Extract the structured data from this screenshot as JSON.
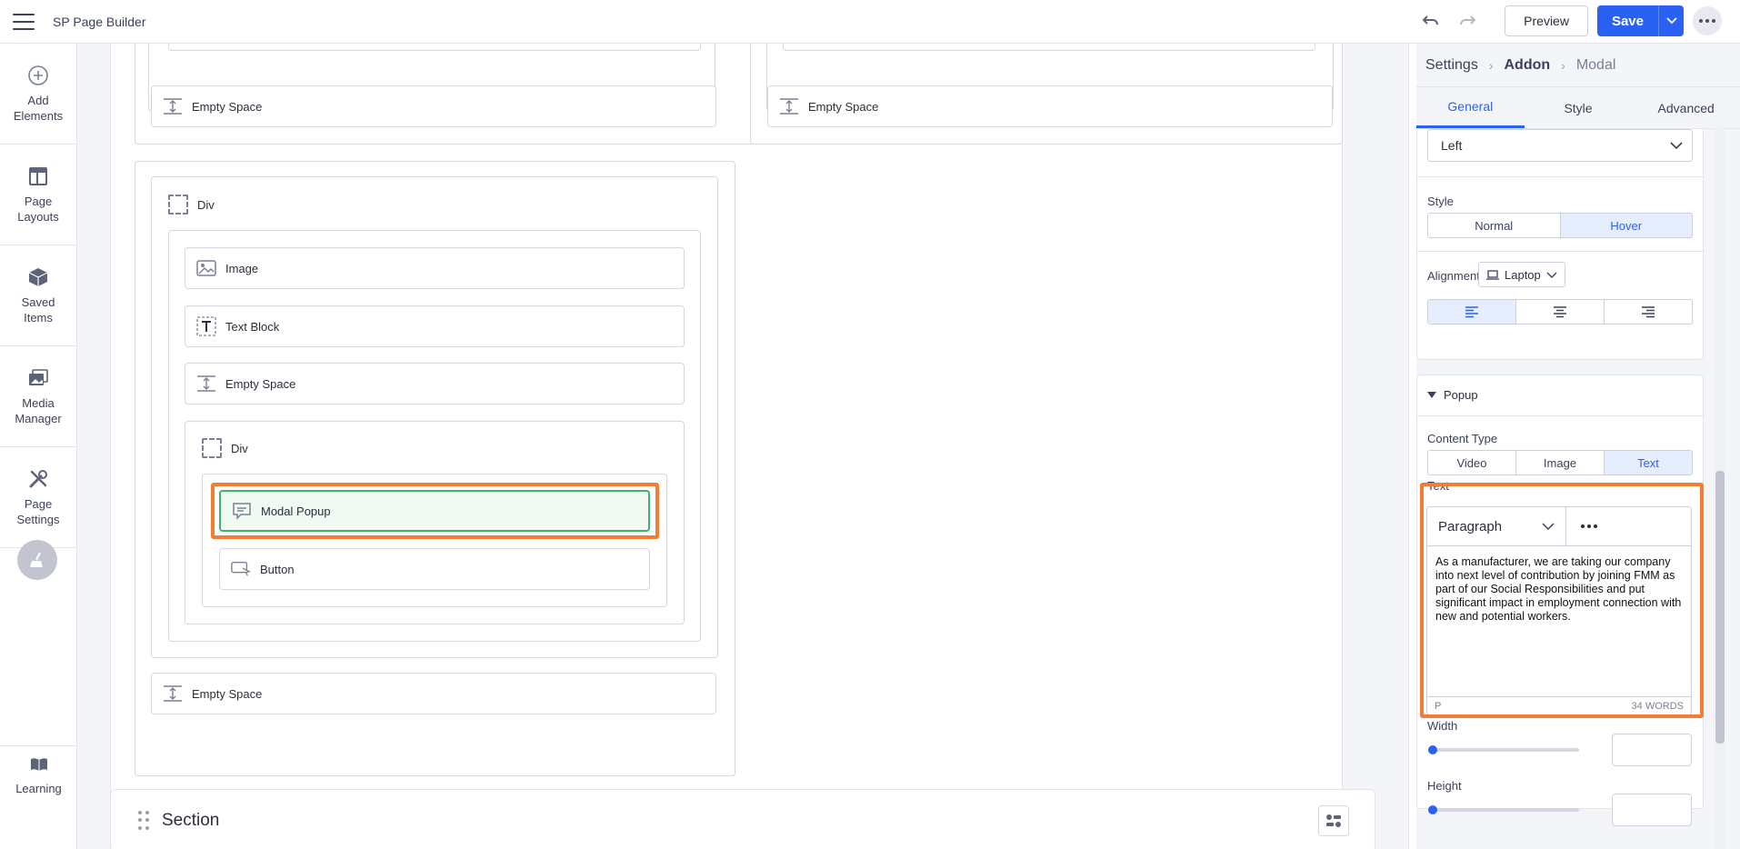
{
  "app": {
    "title": "SP Page Builder"
  },
  "topbar": {
    "preview_label": "Preview",
    "save_label": "Save"
  },
  "sidebar": {
    "items": [
      {
        "label": "Add Elements",
        "icon": "plus-circle-icon"
      },
      {
        "label": "Page Layouts",
        "icon": "layout-icon"
      },
      {
        "label": "Saved Items",
        "icon": "cube-icon"
      },
      {
        "label": "Media Manager",
        "icon": "images-icon"
      },
      {
        "label": "Page Settings",
        "icon": "tools-icon"
      }
    ],
    "learning_label": "Learning"
  },
  "canvas": {
    "top_left_empty": "Empty Space",
    "top_right_empty": "Empty Space",
    "outer_div_label": "Div",
    "image_label": "Image",
    "text_block_label": "Text Block",
    "inner_empty_label": "Empty Space",
    "inner_div_label": "Div",
    "modal_popup_label": "Modal Popup",
    "button_label": "Button",
    "bottom_empty_label": "Empty Space",
    "section_title": "Section"
  },
  "panel": {
    "breadcrumb": [
      "Settings",
      "Addon",
      "Modal"
    ],
    "tabs": [
      "General",
      "Style",
      "Advanced"
    ],
    "position_value": "Left",
    "style_label": "Style",
    "style_options": [
      "Normal",
      "Hover"
    ],
    "alignment_label": "Alignment",
    "device_value": "Laptop",
    "popup_title": "Popup",
    "content_type_label": "Content Type",
    "content_type_options": [
      "Video",
      "Image",
      "Text"
    ],
    "text_label": "Text",
    "editor_format": "Paragraph",
    "editor_text": "As a manufacturer, we are taking our company into next level of contribution by joining FMM as part of our Social Responsibilities and put significant impact in employment connection with new and potential workers.",
    "editor_tag": "P",
    "editor_wordcount": "34 WORDS",
    "width_label": "Width",
    "height_label": "Height"
  },
  "colors": {
    "accent": "#2961f3",
    "highlight": "#f37d35",
    "active_border": "#3cb371"
  }
}
